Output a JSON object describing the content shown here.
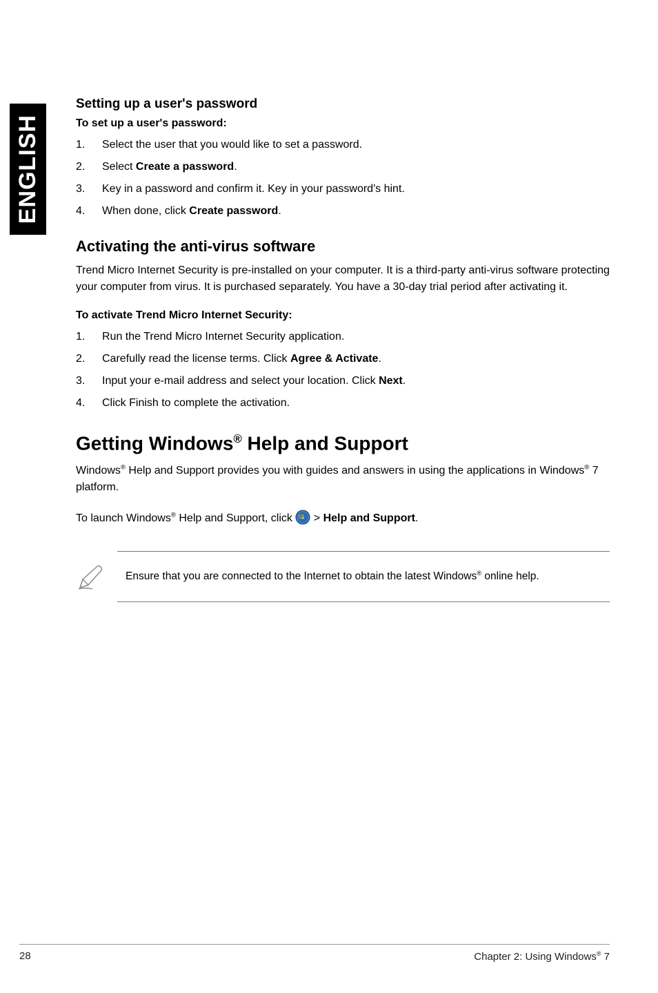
{
  "side_tab": "ENGLISH",
  "s1": {
    "heading": "Setting up a user's password",
    "lead": "To set up a user's password:",
    "items": [
      {
        "pre": "Select the user that you would like to set a password."
      },
      {
        "pre": "Select ",
        "bold": "Create a password",
        "post": "."
      },
      {
        "pre": "Key in a password and confirm it. Key in your password's hint."
      },
      {
        "pre": "When done, click ",
        "bold": "Create password",
        "post": "."
      }
    ]
  },
  "s2": {
    "heading": "Activating the anti-virus software",
    "body": "Trend Micro Internet Security is pre-installed on your computer. It is a third-party anti-virus software protecting your computer from virus. It is purchased separately. You have a 30-day trial period after activating it.",
    "lead": "To activate Trend Micro Internet Security:",
    "items": [
      {
        "pre": "Run the Trend Micro Internet Security application."
      },
      {
        "pre": "Carefully read the license terms. Click ",
        "bold": "Agree & Activate",
        "post": "."
      },
      {
        "pre": "Input your e-mail address and select your location. Click ",
        "bold": "Next",
        "post": "."
      },
      {
        "pre": "Click Finish to complete the activation."
      }
    ]
  },
  "s3": {
    "heading_pre": "Getting Windows",
    "heading_sup": "®",
    "heading_post": " Help and Support",
    "body_parts": {
      "p1a": "Windows",
      "sup": "®",
      "p1b": " Help and Support provides you with guides and answers in using the applications in Windows",
      "p1c": " 7 platform."
    },
    "launch": {
      "a": "To launch Windows",
      "sup": "®",
      "b": " Help and Support, click ",
      "c": " > ",
      "bold": "Help and Support",
      "d": "."
    },
    "note": {
      "a": "Ensure that you are connected to the Internet to obtain the latest Windows",
      "sup": "®",
      "b": " online help."
    }
  },
  "footer": {
    "page": "28",
    "chapter_a": "Chapter 2: Using Windows",
    "chapter_sup": "®",
    "chapter_b": " 7"
  }
}
